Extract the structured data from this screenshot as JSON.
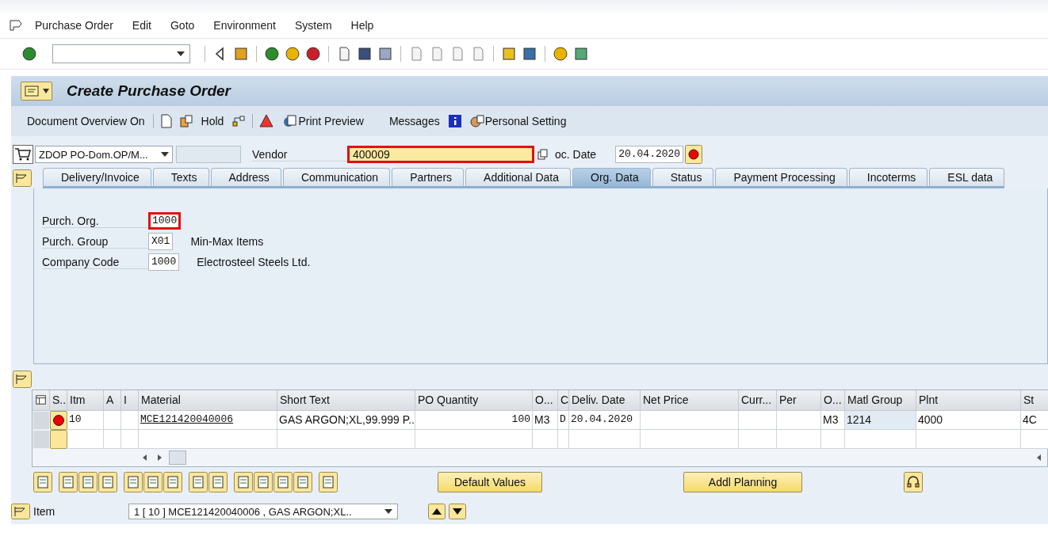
{
  "menu_bar": {
    "items": [
      "Purchase Order",
      "Edit",
      "Goto",
      "Environment",
      "System",
      "Help"
    ]
  },
  "title": "Create Purchase Order",
  "app_toolbar": {
    "document_overview": "Document Overview On",
    "hold": "Hold",
    "print_preview": "Print Preview",
    "messages": "Messages",
    "personal_setting": "Personal Setting"
  },
  "header": {
    "order_type": "ZDOP PO-Dom.OP/M...",
    "vendor_label": "Vendor",
    "vendor": {
      "value": "400009",
      "highlighted": true
    },
    "doc_date_label": "oc. Date",
    "doc_date": "20.04.2020"
  },
  "tabs": [
    {
      "label": "Delivery/Invoice",
      "selected": false
    },
    {
      "label": "Texts",
      "selected": false
    },
    {
      "label": "Address",
      "selected": false
    },
    {
      "label": "Communication",
      "selected": false
    },
    {
      "label": "Partners",
      "selected": false
    },
    {
      "label": "Additional Data",
      "selected": false
    },
    {
      "label": "Org. Data",
      "selected": true
    },
    {
      "label": "Status",
      "selected": false
    },
    {
      "label": "Payment Processing",
      "selected": false
    },
    {
      "label": "Incoterms",
      "selected": false
    },
    {
      "label": "ESL data",
      "selected": false
    }
  ],
  "org_data": {
    "fields": [
      {
        "label": "Purch. Org.",
        "value": "1000",
        "highlighted": true
      },
      {
        "label": "Purch. Group",
        "value": "X01",
        "highlighted": false,
        "description": "Min-Max Items"
      },
      {
        "label": "Company Code",
        "value": "1000",
        "highlighted": false,
        "description": "Electrosteel Steels Ltd."
      }
    ]
  },
  "table": {
    "columns": [
      "S..",
      "Itm",
      "A",
      "I",
      "Material",
      "Short Text",
      "PO Quantity",
      "O...",
      "C",
      "Deliv. Date",
      "Net Price",
      "Curr...",
      "Per",
      "O...",
      "Matl Group",
      "Plnt",
      "St"
    ],
    "rows": [
      {
        "error": true,
        "cells": [
          null,
          "10",
          null,
          null,
          "MCE121420040006",
          "GAS ARGON;XL,99.999 P..",
          "100",
          "M3",
          "D",
          "20.04.2020",
          null,
          null,
          null,
          "M3",
          "1214",
          "4000",
          "4C"
        ]
      },
      {
        "error": false
      }
    ]
  },
  "buttons": [
    "Default Values",
    "Addl Planning"
  ],
  "item_selector": {
    "label": "Item",
    "value": "1 [ 10 ] MCE121420040006 , GAS ARGON;XL.."
  }
}
